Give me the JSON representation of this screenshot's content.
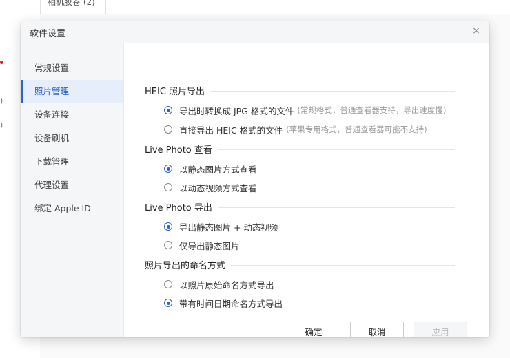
{
  "background": {
    "tab_label": "相机胶卷 (2)",
    "left_fragments": [
      ")",
      ")"
    ]
  },
  "dialog": {
    "title": "软件设置",
    "close_glyph": "×"
  },
  "sidebar": {
    "items": [
      {
        "label": "常规设置",
        "active": false
      },
      {
        "label": "照片管理",
        "active": true
      },
      {
        "label": "设备连接",
        "active": false
      },
      {
        "label": "设备刷机",
        "active": false
      },
      {
        "label": "下载管理",
        "active": false
      },
      {
        "label": "代理设置",
        "active": false
      },
      {
        "label": "绑定 Apple ID",
        "active": false
      }
    ]
  },
  "sections": [
    {
      "title": "HEIC 照片导出",
      "options": [
        {
          "label": "导出时转换成 JPG 格式的文件",
          "note": "(常规格式，普通查看器支持，导出速度慢)",
          "selected": true
        },
        {
          "label": "直接导出 HEIC 格式的文件",
          "note": "(苹果专用格式，普通查看器可能不支持)",
          "selected": false
        }
      ]
    },
    {
      "title": "Live Photo 查看",
      "options": [
        {
          "label": "以静态图片方式查看",
          "note": "",
          "selected": true
        },
        {
          "label": "以动态视频方式查看",
          "note": "",
          "selected": false
        }
      ]
    },
    {
      "title": "Live Photo 导出",
      "options": [
        {
          "label": "导出静态图片 + 动态视频",
          "note": "",
          "selected": true
        },
        {
          "label": "仅导出静态图片",
          "note": "",
          "selected": false
        }
      ]
    },
    {
      "title": "照片导出的命名方式",
      "options": [
        {
          "label": "以照片原始命名方式导出",
          "note": "",
          "selected": false
        },
        {
          "label": "带有时间日期命名方式导出",
          "note": "",
          "selected": true
        }
      ]
    }
  ],
  "buttons": {
    "confirm": "确定",
    "cancel": "取消",
    "apply": "应用"
  },
  "colors": {
    "accent": "#2b63c9",
    "sidebar_bg": "#f5f6f8",
    "active_bg": "#e6eefb"
  }
}
